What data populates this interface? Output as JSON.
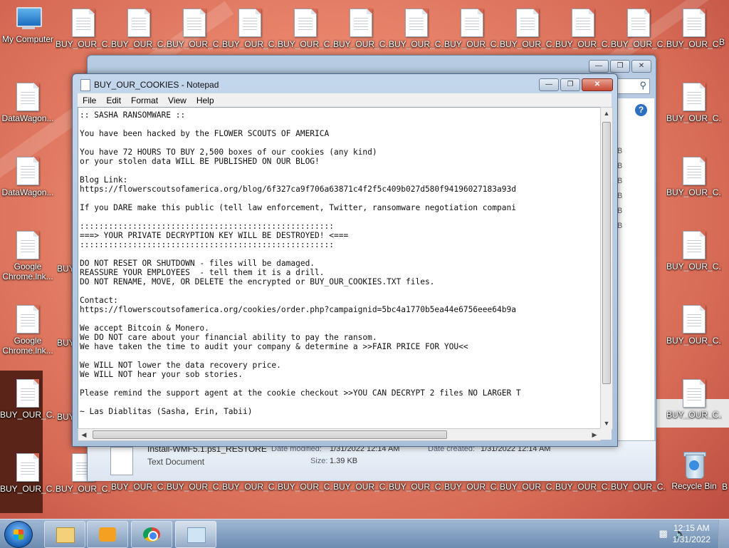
{
  "desktop": {
    "icons": {
      "my_computer": "My Computer",
      "buy_our_c": "BUY_OUR_C...",
      "buy_our_c_short": "BUY_OUR_C...",
      "datawagon": "DataWagon...",
      "google_chrome_line1": "Google",
      "google_chrome_line2": "Chrome.lnk...",
      "buy_partial": "BUY",
      "recycle_bin": "Recycle Bin",
      "b_partial": "B"
    }
  },
  "explorer": {
    "size_letter": "B",
    "details": {
      "file_name": "Install-WMF5.1.ps1_RESTORE",
      "date_modified_label": "Date modified:",
      "date_modified_value": "1/31/2022 12:14 AM",
      "date_created_label": "Date created:",
      "date_created_value": "1/31/2022 12:14 AM",
      "file_type": "Text Document",
      "size_label": "Size:",
      "size_value": "1.39 KB"
    }
  },
  "notepad": {
    "title": "BUY_OUR_COOKIES - Notepad",
    "menu": [
      "File",
      "Edit",
      "Format",
      "View",
      "Help"
    ],
    "lines": [
      ":: SASHA RANSOMWARE ::",
      "",
      "You have been hacked by the FLOWER SCOUTS OF AMERICA",
      "",
      "You have 72 HOURS TO BUY 2,500 boxes of our cookies (any kind)",
      "or your stolen data WILL BE PUBLISHED ON OUR BLOG!",
      "",
      "Blog Link:",
      "https://flowerscoutsofamerica.org/blog/6f327ca9f706a63871c4f2f5c409b027d580f94196027183a93d",
      "",
      "If you DARE make this public (tell law enforcement, Twitter, ransomware negotiation compani",
      "",
      ":::::::::::::::::::::::::::::::::::::::::::::::::::::",
      "===> YOUR PRIVATE DECRYPTION KEY WILL BE DESTROYED! <===",
      ":::::::::::::::::::::::::::::::::::::::::::::::::::::",
      "",
      "DO NOT RESET OR SHUTDOWN - files will be damaged.",
      "REASSURE YOUR EMPLOYEES  - tell them it is a drill.",
      "DO NOT RENAME, MOVE, OR DELETE the encrypted or BUY_OUR_COOKIES.TXT files.",
      "",
      "Contact:",
      "https://flowerscoutsofamerica.org/cookies/order.php?campaignid=5bc4a1770b5ea44e6756eee64b9a",
      "",
      "We accept Bitcoin & Monero.",
      "We DO NOT care about your financial ability to pay the ransom.",
      "We have taken the time to audit your company & determine a >>FAIR PRICE FOR YOU<<",
      "",
      "We WILL NOT lower the data recovery price.",
      "We WILL NOT hear your sob stories.",
      "",
      "Please remind the support agent at the cookie checkout >>YOU CAN DECRYPT 2 files NO LARGER T",
      "",
      "~ Las Diablitas (Sasha, Erin, Tabii)"
    ]
  },
  "taskbar": {
    "time": "12:15 AM",
    "date": "1/31/2022"
  },
  "icons": {
    "minimize": "minimize-icon",
    "maximize": "maximize-icon",
    "close": "close-icon",
    "search": "search-icon",
    "help": "help-icon"
  },
  "colors": {
    "accent": "#1b6dc1",
    "close_red": "#c74a35",
    "taskbar": "#6d8cb2"
  }
}
